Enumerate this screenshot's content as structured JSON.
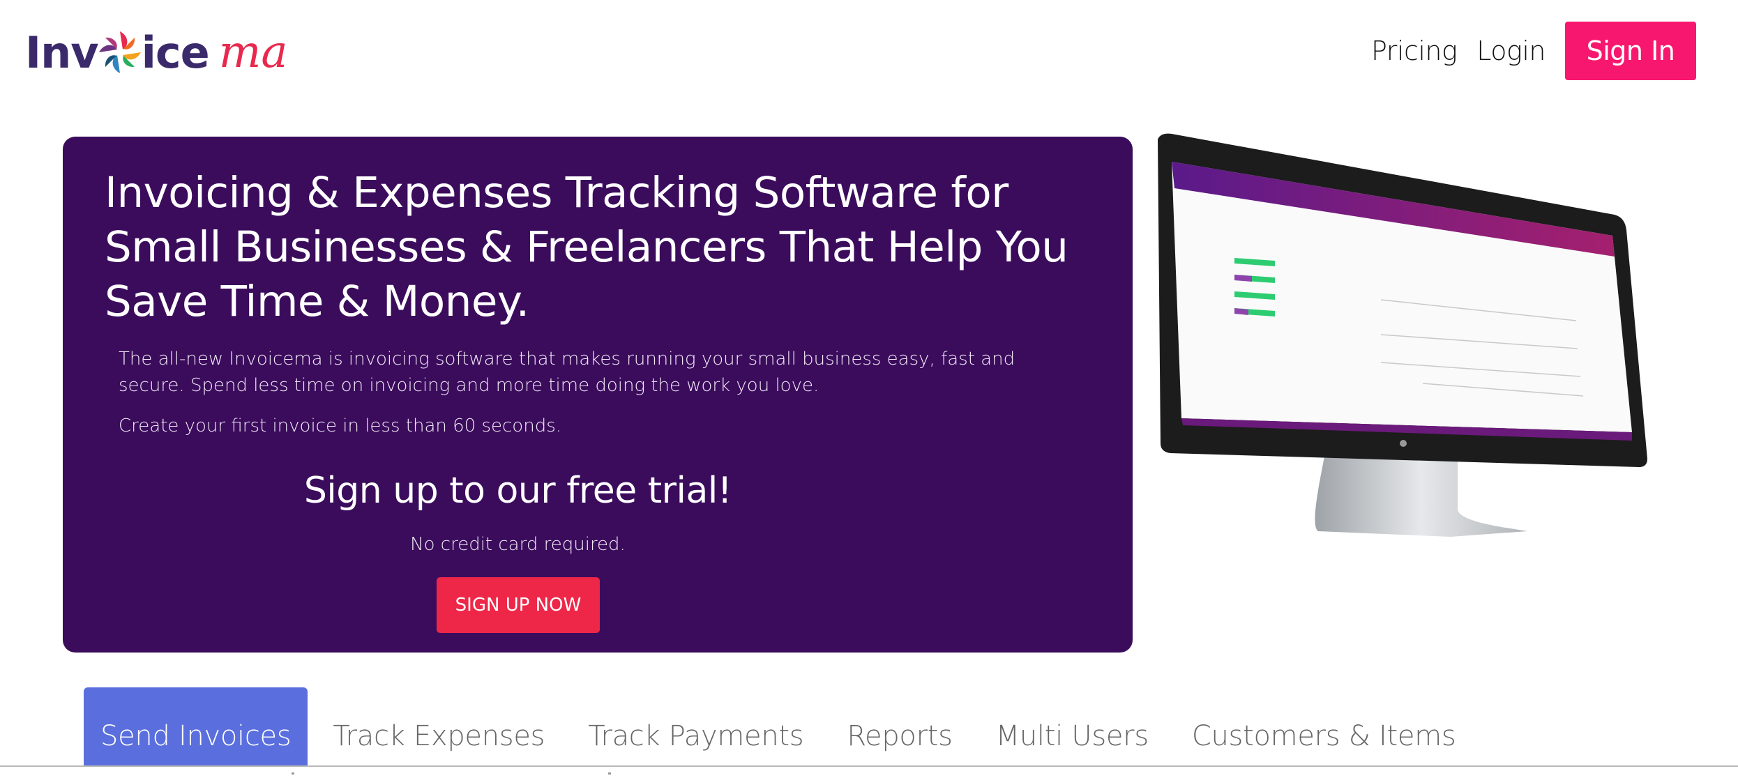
{
  "header": {
    "logo_brand_part1": "Inv",
    "logo_brand_part2": "ice",
    "logo_brand_part3": "ma",
    "nav": {
      "pricing": "Pricing",
      "login": "Login",
      "sign_in": "Sign In"
    }
  },
  "hero": {
    "title": "Invoicing & Expenses Tracking Software for Small Businesses & Freelancers That Help You Save Time & Money.",
    "description": "The all-new Invoicema is invoicing software that makes running your small business easy, fast and secure. Spend less time on invoicing and more time doing the work you love.",
    "subtitle": "Create your first invoice in less than 60 seconds.",
    "cta_title": "Sign up to our free trial!",
    "cta_note": "No credit card required.",
    "cta_button": "SIGN UP NOW"
  },
  "tabs": [
    {
      "label": "Send Invoices",
      "active": true
    },
    {
      "label": "Track Expenses",
      "active": false
    },
    {
      "label": "Track Payments",
      "active": false
    },
    {
      "label": "Reports",
      "active": false
    },
    {
      "label": "Multi Users",
      "active": false
    },
    {
      "label": "Customers & Items",
      "active": false
    }
  ],
  "colors": {
    "hero_bg": "#3b0c5c",
    "sign_in_bg": "#f8176e",
    "cta_bg": "#ee2748",
    "active_tab_bg": "#5a6fdd",
    "logo_dark": "#3b2a6b",
    "logo_accent": "#e8294f"
  },
  "icons": {
    "logo_mark": "pinwheel-icon",
    "monitor_image": "desktop-monitor-screenshot"
  }
}
